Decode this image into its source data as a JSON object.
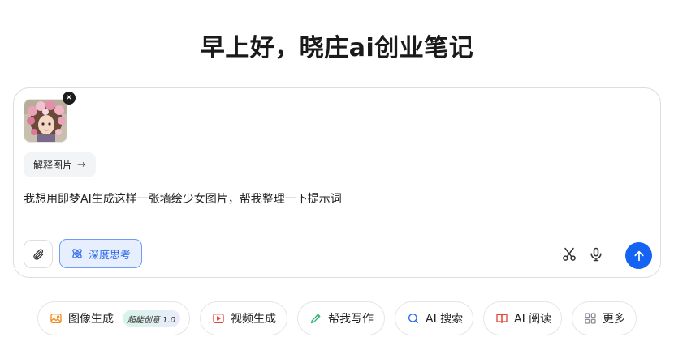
{
  "greeting": "早上好，晓庄ai创业笔记",
  "composer": {
    "attachment": {
      "thumbnail": "girl-with-flowers-image",
      "close_label": "×"
    },
    "explain_chip": {
      "label": "解释图片",
      "arrow": "→"
    },
    "prompt_text": "我想用即梦AI生成这样一张墙绘少女图片，帮我整理一下提示词",
    "deep_think_label": "深度思考",
    "icons": [
      "paperclip-icon",
      "atom-icon",
      "scissors-icon",
      "microphone-icon",
      "send-arrow-icon"
    ],
    "accent_color": "#1463f3"
  },
  "quick_actions": [
    {
      "label": "图像生成",
      "badge": "超能创意 1.0",
      "icon": "image-gen-icon",
      "color": "#f08c1a"
    },
    {
      "label": "视频生成",
      "icon": "video-gen-icon",
      "color": "#e8453c"
    },
    {
      "label": "帮我写作",
      "icon": "pen-icon",
      "color": "#2bb673"
    },
    {
      "label": "AI 搜索",
      "icon": "search-sparkle-icon",
      "color": "#2f6ce8"
    },
    {
      "label": "AI 阅读",
      "icon": "book-icon",
      "color": "#e8453c"
    },
    {
      "label": "更多",
      "icon": "grid-icon",
      "color": "#8a8f98"
    }
  ]
}
